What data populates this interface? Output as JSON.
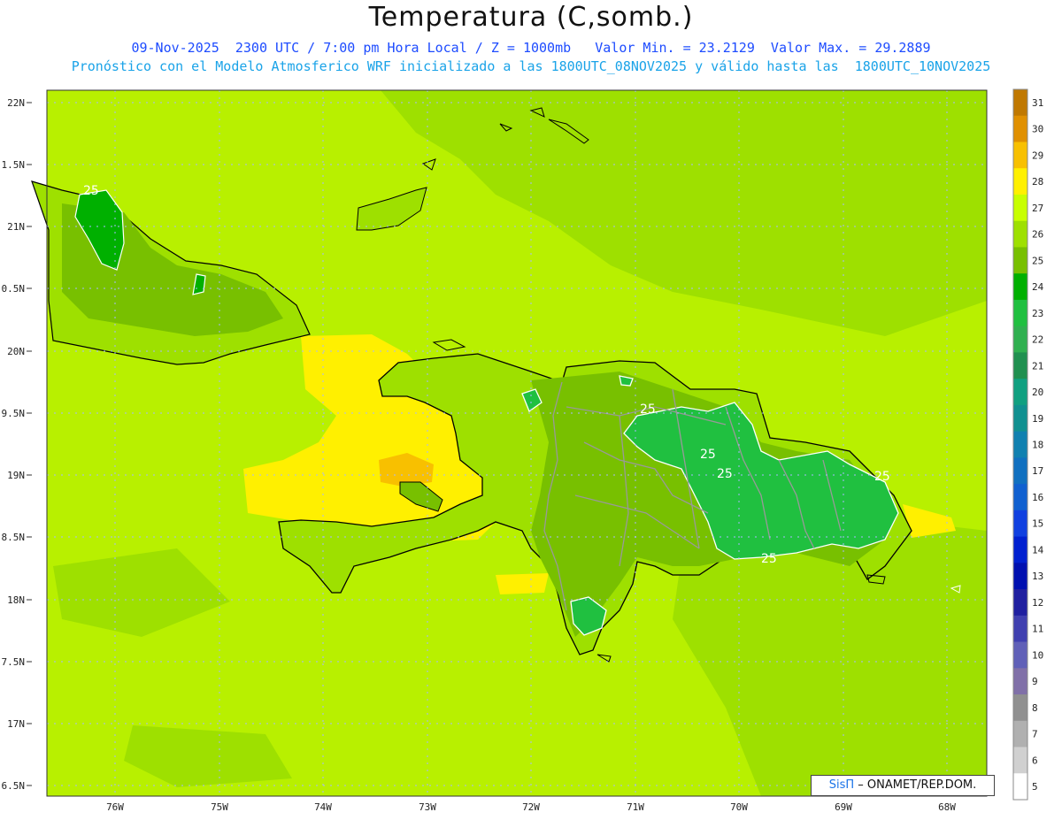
{
  "header": {
    "title": "Temperatura (C,somb.)",
    "line1": "09-Nov-2025  2300 UTC / 7:00 pm Hora Local / Z = 1000mb   Valor Min. = 23.2129  Valor Max. = 29.2889",
    "line2": "Pronóstico con el Modelo Atmosferico WRF inicializado a las 1800UTC_08NOV2025 y válido hasta las  1800UTC_10NOV2025"
  },
  "axes": {
    "lat_labels": [
      "22N",
      "1.5N",
      "21N",
      "0.5N",
      "20N",
      "9.5N",
      "19N",
      "8.5N",
      "18N",
      "7.5N",
      "17N",
      "6.5N"
    ],
    "lon_labels": [
      "76W",
      "75W",
      "74W",
      "73W",
      "72W",
      "71W",
      "70W",
      "69W",
      "68W"
    ]
  },
  "colorbar": {
    "labels": [
      "31",
      "30",
      "29",
      "28",
      "27",
      "26",
      "25",
      "24",
      "23",
      "22",
      "21",
      "20",
      "19",
      "18",
      "17",
      "16",
      "15",
      "14",
      "13",
      "12",
      "11",
      "10",
      "9",
      "8",
      "7",
      "6",
      "5"
    ],
    "colors": [
      "#c07800",
      "#e09000",
      "#f8c000",
      "#fff000",
      "#c8ff00",
      "#9ee000",
      "#78c000",
      "#00b000",
      "#20c040",
      "#30b050",
      "#209050",
      "#10a080",
      "#109090",
      "#1080b0",
      "#1070c0",
      "#1060d0",
      "#1040e0",
      "#0020d0",
      "#0010b0",
      "#2020a0",
      "#4040b0",
      "#6060b8",
      "#8070a8",
      "#909090",
      "#b0b0b0",
      "#d0d0d0",
      "#ffffff"
    ]
  },
  "contour_labels": [
    "25",
    "25",
    "25",
    "25",
    "25",
    "25"
  ],
  "credit": {
    "sis": "SisΠ",
    "rest": "– ONAMET/REP.DOM."
  }
}
